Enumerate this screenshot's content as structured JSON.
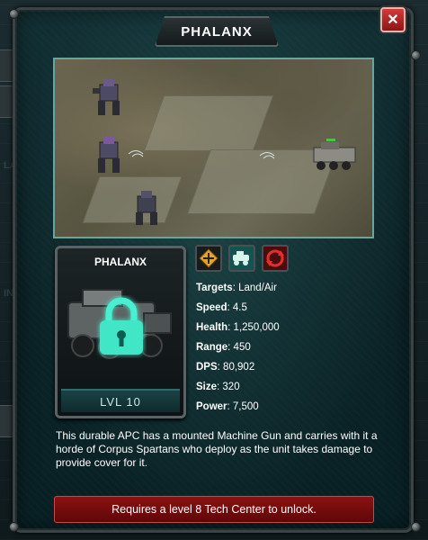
{
  "dialog": {
    "title": "PHALANX",
    "close_label": "✕"
  },
  "unit": {
    "name": "PHALANX",
    "level": "LVL 10",
    "lock_icon": "lock-icon"
  },
  "abilities": [
    {
      "icon": "crosshair-target-icon"
    },
    {
      "icon": "vehicle-icon"
    },
    {
      "icon": "refresh-cycle-icon"
    }
  ],
  "stats": [
    {
      "label": "Targets",
      "value": "Land/Air"
    },
    {
      "label": "Speed",
      "value": "4.5"
    },
    {
      "label": "Health",
      "value": "1,250,000"
    },
    {
      "label": "Range",
      "value": "450"
    },
    {
      "label": "DPS",
      "value": "80,902"
    },
    {
      "label": "Size",
      "value": "320"
    },
    {
      "label": "Power",
      "value": "7,500"
    }
  ],
  "description": "This durable APC has a mounted Machine Gun and carries with it a horde of Corpus Spartans who deploy as the unit takes damage to provide cover for it.",
  "unlock_requirement": "Requires a level 8 Tech Center to unlock.",
  "colors": {
    "panel_bg": "#0b2226",
    "accent_teal": "#6aa59d",
    "unlock_red": "#8b1212",
    "lock_glow": "#46f0d0"
  }
}
